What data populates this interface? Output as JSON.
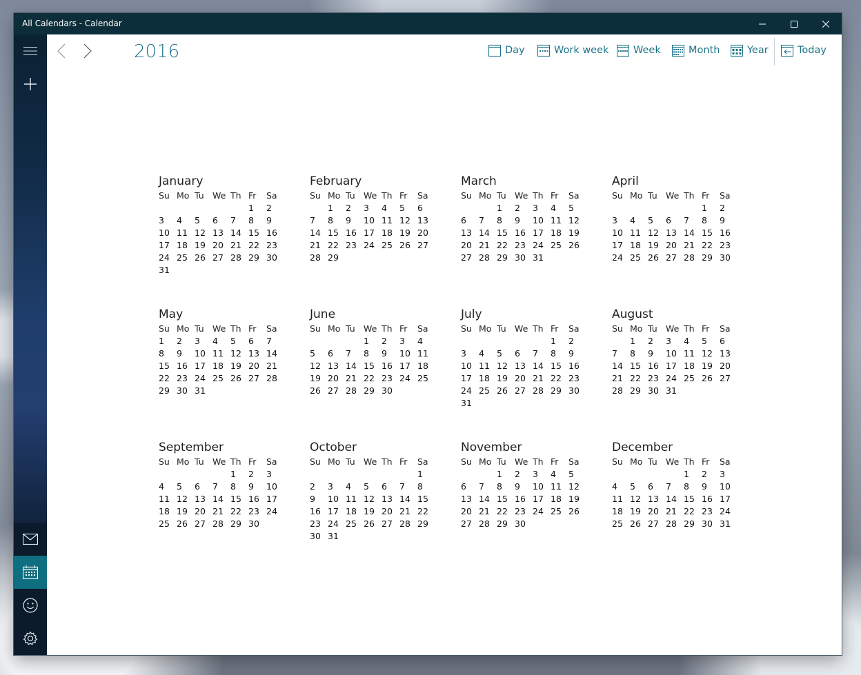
{
  "window": {
    "title": "All Calendars - Calendar"
  },
  "toolbar": {
    "year": "2016",
    "views": [
      {
        "label": "Day",
        "icon": "day-view-icon"
      },
      {
        "label": "Work week",
        "icon": "work-week-icon"
      },
      {
        "label": "Week",
        "icon": "week-view-icon"
      },
      {
        "label": "Month",
        "icon": "month-view-icon"
      },
      {
        "label": "Year",
        "icon": "year-view-icon"
      },
      {
        "label": "Today",
        "icon": "today-icon"
      }
    ]
  },
  "sidebar": {
    "items": [
      "hamburger-menu-icon",
      "new-event-icon",
      "mail-icon",
      "calendar-icon",
      "feedback-icon",
      "settings-icon"
    ],
    "active": "calendar-icon"
  },
  "weekdays": [
    "Su",
    "Mo",
    "Tu",
    "We",
    "Th",
    "Fr",
    "Sa"
  ],
  "months": [
    {
      "name": "January",
      "start": 5,
      "days": 31
    },
    {
      "name": "February",
      "start": 1,
      "days": 29
    },
    {
      "name": "March",
      "start": 2,
      "days": 31
    },
    {
      "name": "April",
      "start": 5,
      "days": 30
    },
    {
      "name": "May",
      "start": 0,
      "days": 31
    },
    {
      "name": "June",
      "start": 3,
      "days": 30
    },
    {
      "name": "July",
      "start": 5,
      "days": 31
    },
    {
      "name": "August",
      "start": 1,
      "days": 31
    },
    {
      "name": "September",
      "start": 4,
      "days": 30
    },
    {
      "name": "October",
      "start": 6,
      "days": 31
    },
    {
      "name": "November",
      "start": 2,
      "days": 30
    },
    {
      "name": "December",
      "start": 4,
      "days": 31
    }
  ],
  "colors": {
    "accent": "#1c7488",
    "titlebar": "#0b2e3a",
    "sidebar_active": "#0f6e80"
  }
}
